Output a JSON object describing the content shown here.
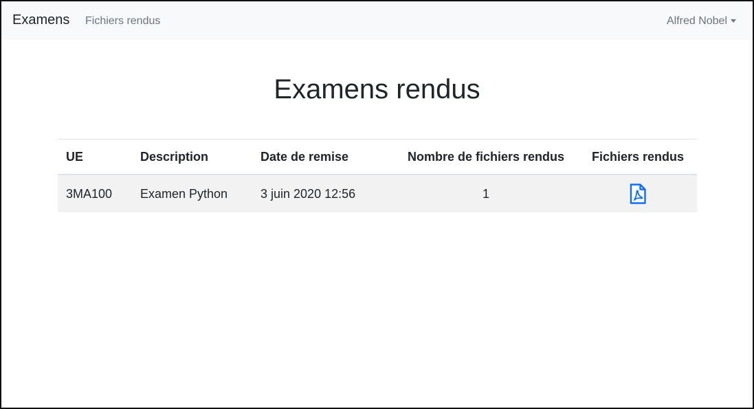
{
  "navbar": {
    "brand": "Examens",
    "links": [
      {
        "label": "Fichiers rendus"
      }
    ],
    "user": "Alfred Nobel"
  },
  "main": {
    "title": "Examens rendus",
    "table": {
      "headers": [
        "UE",
        "Description",
        "Date de remise",
        "Nombre de fichiers rendus",
        "Fichiers rendus"
      ],
      "rows": [
        {
          "ue": "3MA100",
          "description": "Examen Python",
          "date": "3 juin 2020 12:56",
          "count": "1",
          "file_icon": "file-pdf-icon"
        }
      ]
    }
  },
  "colors": {
    "navbar_bg": "#f8f9fa",
    "link_muted": "#6c757d",
    "accent": "#0d6efd",
    "row_stripe": "#f2f2f2"
  }
}
